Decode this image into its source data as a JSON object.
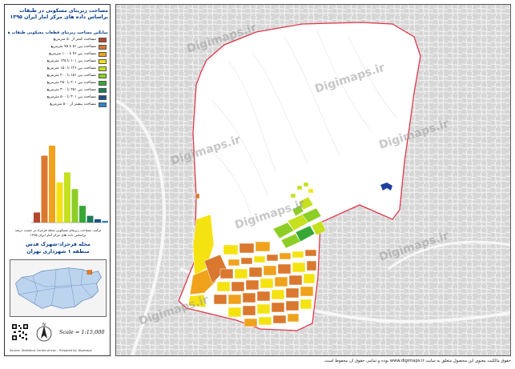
{
  "title": {
    "line1": "مساحت زیربنای مسکونی در طبقات",
    "line2": "براساس داده های مرکز آمار ایران ۱۳۹۵"
  },
  "legend": {
    "heading": "میانگین مساحت زیربنای قطعات مسکونی طبقات ها",
    "items": [
      {
        "label": "مساحت کمتر از ۵۰ مترمربع",
        "color": "#b5462a"
      },
      {
        "label": "مساحت بین ۵۱ تا ۷۵ مترمربع",
        "color": "#d9782e"
      },
      {
        "label": "مساحت بین ۷۶ تا ۱۰۰ مترمربع",
        "color": "#f0a21c"
      },
      {
        "label": "مساحت بین ۱۰۱ تا ۱۲۵ مترمربع",
        "color": "#f5e211"
      },
      {
        "label": "مساحت بین ۱۲۶ تا ۱۵۰ مترمربع",
        "color": "#c5e01e"
      },
      {
        "label": "مساحت بین ۱۵۱ تا ۲۰۰ مترمربع",
        "color": "#8dce26"
      },
      {
        "label": "مساحت بین ۲۰۱ تا ۲۵۰ مترمربع",
        "color": "#37a836"
      },
      {
        "label": "مساحت بین ۲۵۱ تا ۳۰۰ مترمربع",
        "color": "#1e7b5a"
      },
      {
        "label": "مساحت بین ۳۰۱ تا ۵۰۰ مترمربع",
        "color": "#1f4f8c"
      },
      {
        "label": "مساحت بیشتر از ۵۰۰ مترمربع",
        "color": "#2a85c9"
      }
    ]
  },
  "histogram": {
    "values": [
      6,
      40,
      46,
      24,
      30,
      20,
      10,
      4,
      2,
      1
    ],
    "caption_line1": "ترکیب مساحت زیربنای مسکونی محله فرحزاد بر حسب درصد",
    "caption_line2": "براساس داده های مرکز آمار ایران ۱۳۹۵"
  },
  "place": {
    "district": "محله فرحزاد-شهرک قدس",
    "region": "منطقه ۱ شهرداری تهران"
  },
  "scale": "Scale = 1:15,000",
  "footer_small": "Source: Statistical Centre of Iran ; Prepared by: Digimaps",
  "watermark": "Digimaps.ir",
  "copyright": "حقوق مالکیت معنوی این محصول متعلق به سایت www.digimaps.ir بوده و تمامی حقوق آن محفوظ است.",
  "colors": {
    "title": "#003a8c",
    "boundary": "#e0384a",
    "street_bg": "#d8d8d8",
    "study_area": "#ffffff",
    "water": "#1f3f9e"
  }
}
